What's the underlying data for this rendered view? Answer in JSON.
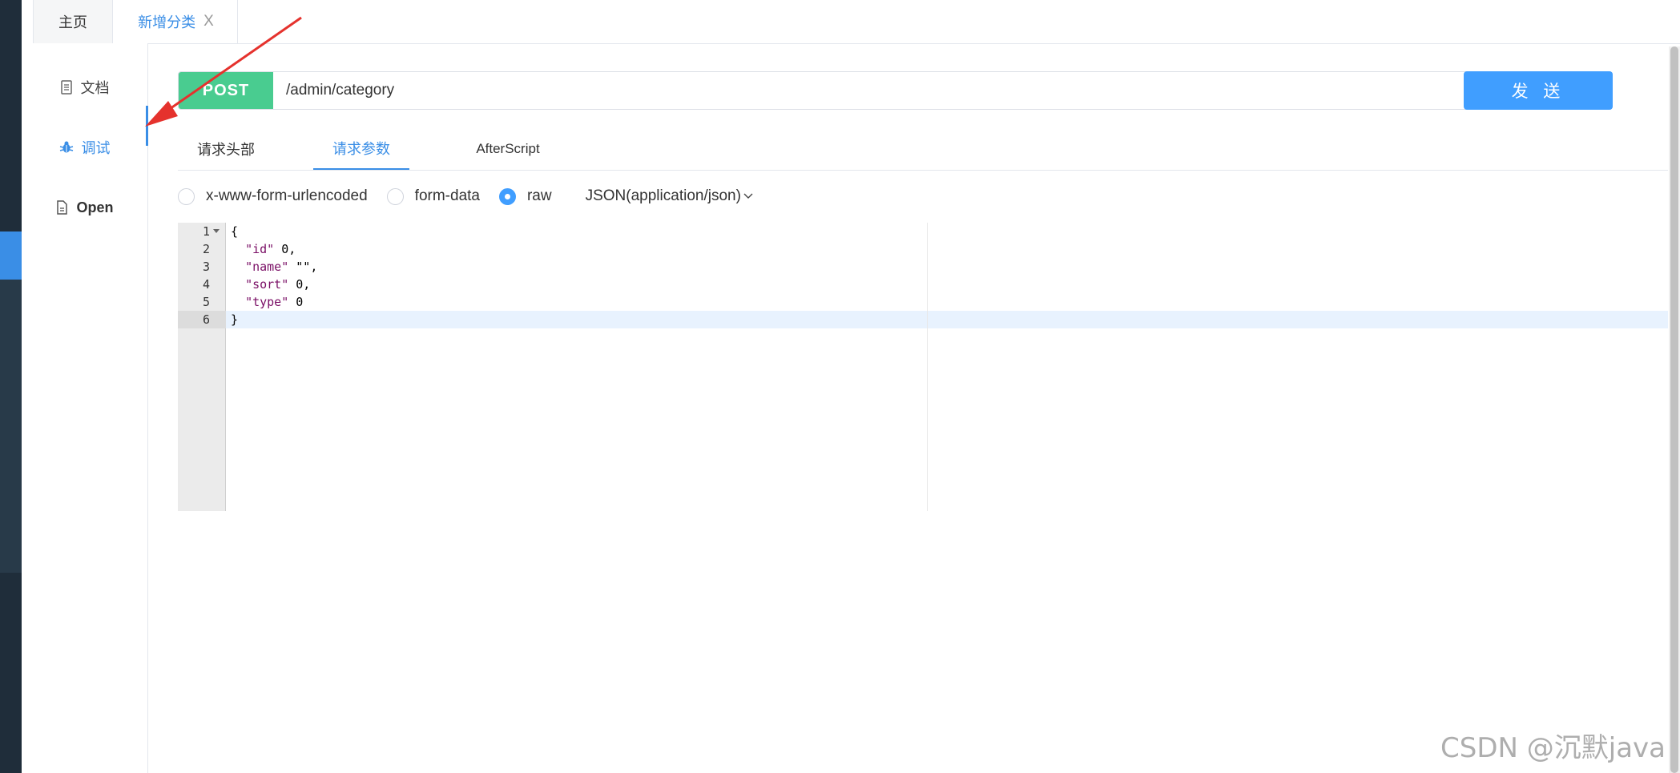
{
  "tabs": {
    "home": "主页",
    "active": "新增分类",
    "close_glyph": "X"
  },
  "nav": {
    "doc": "文档",
    "debug": "调试",
    "open": "Open"
  },
  "request": {
    "method": "POST",
    "url": "/admin/category",
    "send_label": "发 送",
    "method_color": "#49cc90",
    "accent_color": "#409eff"
  },
  "req_tabs": [
    "请求头部",
    "请求参数",
    "AfterScript"
  ],
  "body_types": {
    "urlencoded": "x-www-form-urlencoded",
    "formdata": "form-data",
    "raw": "raw",
    "selected": "raw",
    "content_type": "JSON(application/json)"
  },
  "editor": {
    "line_numbers": [
      "1",
      "2",
      "3",
      "4",
      "5",
      "6"
    ],
    "lines": [
      "{",
      "  \"id\": 0,",
      "  \"name\": \"\",",
      "  \"sort\": 0,",
      "  \"type\": 0",
      "}"
    ],
    "active_line": 6
  },
  "watermark": "CSDN @沉默java"
}
